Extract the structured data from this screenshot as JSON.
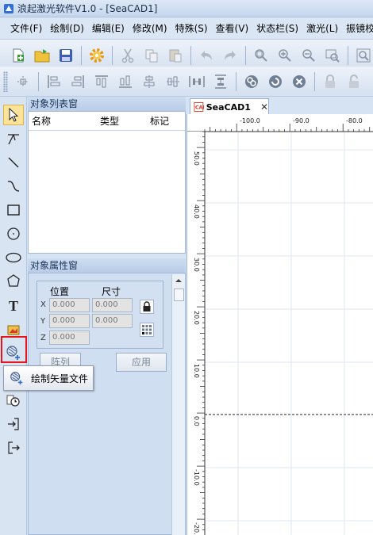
{
  "window": {
    "title": "浪起激光软件V1.0 - [SeaCAD1]"
  },
  "menu": [
    "文件(F)",
    "绘制(D)",
    "编辑(E)",
    "修改(M)",
    "特殊(S)",
    "查看(V)",
    "状态栏(S)",
    "激光(L)",
    "振镜校"
  ],
  "toolbar1": {
    "icons": [
      "new-file-icon",
      "open-folder-icon",
      "save-icon",
      "settings-gear-icon",
      "cut-icon",
      "copy-icon",
      "paste-icon",
      "undo-icon",
      "redo-icon",
      "zoom-fit-icon",
      "zoom-in-icon",
      "zoom-out-icon",
      "zoom-window-icon",
      "zoom-all-icon"
    ]
  },
  "toolbar2": {
    "icons": [
      "center-align-icon",
      "align-left-icon",
      "align-right-icon",
      "align-top-icon",
      "align-bottom-icon",
      "align-hcenter-icon",
      "align-vcenter-icon",
      "distribute-h-icon",
      "distribute-v-icon",
      "group-icon",
      "ungroup-icon",
      "delete-icon",
      "lock-icon",
      "unlock-icon"
    ]
  },
  "left_tools": [
    "select-arrow-icon",
    "point-icon",
    "line-icon",
    "curve-icon",
    "rectangle-icon",
    "circle-icon",
    "ellipse-icon",
    "polygon-icon",
    "text-icon",
    "image-icon",
    "vector-file-icon",
    "timer-icon",
    "input-icon",
    "output-icon"
  ],
  "object_list": {
    "title": "对象列表窗",
    "columns": [
      "名称",
      "类型",
      "标记"
    ]
  },
  "object_props": {
    "title": "对象属性窗",
    "position_label": "位置",
    "size_label": "尺寸",
    "axis_x": "X",
    "axis_y": "Y",
    "axis_z": "Z",
    "x_value": "0.000",
    "y_value": "0.000",
    "z_value": "0.000",
    "width_value": "0.000",
    "height_value": "0.000",
    "array_button": "阵列",
    "apply_button": "应用"
  },
  "tooltip": {
    "text": "绘制矢量文件"
  },
  "document": {
    "tab_label": "SeaCAD1",
    "close_glyph": "✕"
  },
  "ruler": {
    "h_labels": [
      "-100.0",
      "-90.0",
      "-80.0"
    ],
    "v_labels": [
      "50.0",
      "40.0",
      "30.0",
      "20.0",
      "10.0",
      "0.0",
      "-10.0",
      "-20.0"
    ]
  }
}
